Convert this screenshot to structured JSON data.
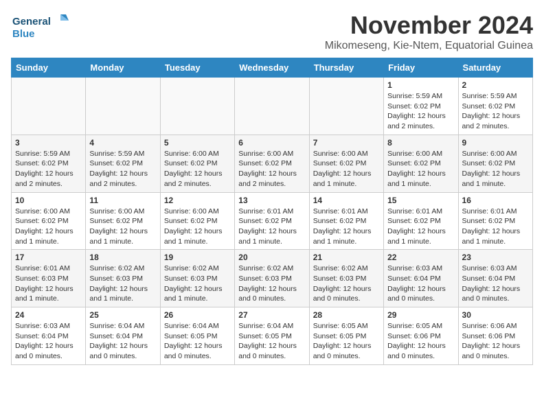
{
  "logo": {
    "line1": "General",
    "line2": "Blue"
  },
  "title": "November 2024",
  "subtitle": "Mikomeseng, Kie-Ntem, Equatorial Guinea",
  "weekdays": [
    "Sunday",
    "Monday",
    "Tuesday",
    "Wednesday",
    "Thursday",
    "Friday",
    "Saturday"
  ],
  "weeks": [
    [
      {
        "day": "",
        "info": ""
      },
      {
        "day": "",
        "info": ""
      },
      {
        "day": "",
        "info": ""
      },
      {
        "day": "",
        "info": ""
      },
      {
        "day": "",
        "info": ""
      },
      {
        "day": "1",
        "info": "Sunrise: 5:59 AM\nSunset: 6:02 PM\nDaylight: 12 hours and 2 minutes."
      },
      {
        "day": "2",
        "info": "Sunrise: 5:59 AM\nSunset: 6:02 PM\nDaylight: 12 hours and 2 minutes."
      }
    ],
    [
      {
        "day": "3",
        "info": "Sunrise: 5:59 AM\nSunset: 6:02 PM\nDaylight: 12 hours and 2 minutes."
      },
      {
        "day": "4",
        "info": "Sunrise: 5:59 AM\nSunset: 6:02 PM\nDaylight: 12 hours and 2 minutes."
      },
      {
        "day": "5",
        "info": "Sunrise: 6:00 AM\nSunset: 6:02 PM\nDaylight: 12 hours and 2 minutes."
      },
      {
        "day": "6",
        "info": "Sunrise: 6:00 AM\nSunset: 6:02 PM\nDaylight: 12 hours and 2 minutes."
      },
      {
        "day": "7",
        "info": "Sunrise: 6:00 AM\nSunset: 6:02 PM\nDaylight: 12 hours and 1 minute."
      },
      {
        "day": "8",
        "info": "Sunrise: 6:00 AM\nSunset: 6:02 PM\nDaylight: 12 hours and 1 minute."
      },
      {
        "day": "9",
        "info": "Sunrise: 6:00 AM\nSunset: 6:02 PM\nDaylight: 12 hours and 1 minute."
      }
    ],
    [
      {
        "day": "10",
        "info": "Sunrise: 6:00 AM\nSunset: 6:02 PM\nDaylight: 12 hours and 1 minute."
      },
      {
        "day": "11",
        "info": "Sunrise: 6:00 AM\nSunset: 6:02 PM\nDaylight: 12 hours and 1 minute."
      },
      {
        "day": "12",
        "info": "Sunrise: 6:00 AM\nSunset: 6:02 PM\nDaylight: 12 hours and 1 minute."
      },
      {
        "day": "13",
        "info": "Sunrise: 6:01 AM\nSunset: 6:02 PM\nDaylight: 12 hours and 1 minute."
      },
      {
        "day": "14",
        "info": "Sunrise: 6:01 AM\nSunset: 6:02 PM\nDaylight: 12 hours and 1 minute."
      },
      {
        "day": "15",
        "info": "Sunrise: 6:01 AM\nSunset: 6:02 PM\nDaylight: 12 hours and 1 minute."
      },
      {
        "day": "16",
        "info": "Sunrise: 6:01 AM\nSunset: 6:02 PM\nDaylight: 12 hours and 1 minute."
      }
    ],
    [
      {
        "day": "17",
        "info": "Sunrise: 6:01 AM\nSunset: 6:03 PM\nDaylight: 12 hours and 1 minute."
      },
      {
        "day": "18",
        "info": "Sunrise: 6:02 AM\nSunset: 6:03 PM\nDaylight: 12 hours and 1 minute."
      },
      {
        "day": "19",
        "info": "Sunrise: 6:02 AM\nSunset: 6:03 PM\nDaylight: 12 hours and 1 minute."
      },
      {
        "day": "20",
        "info": "Sunrise: 6:02 AM\nSunset: 6:03 PM\nDaylight: 12 hours and 0 minutes."
      },
      {
        "day": "21",
        "info": "Sunrise: 6:02 AM\nSunset: 6:03 PM\nDaylight: 12 hours and 0 minutes."
      },
      {
        "day": "22",
        "info": "Sunrise: 6:03 AM\nSunset: 6:04 PM\nDaylight: 12 hours and 0 minutes."
      },
      {
        "day": "23",
        "info": "Sunrise: 6:03 AM\nSunset: 6:04 PM\nDaylight: 12 hours and 0 minutes."
      }
    ],
    [
      {
        "day": "24",
        "info": "Sunrise: 6:03 AM\nSunset: 6:04 PM\nDaylight: 12 hours and 0 minutes."
      },
      {
        "day": "25",
        "info": "Sunrise: 6:04 AM\nSunset: 6:04 PM\nDaylight: 12 hours and 0 minutes."
      },
      {
        "day": "26",
        "info": "Sunrise: 6:04 AM\nSunset: 6:05 PM\nDaylight: 12 hours and 0 minutes."
      },
      {
        "day": "27",
        "info": "Sunrise: 6:04 AM\nSunset: 6:05 PM\nDaylight: 12 hours and 0 minutes."
      },
      {
        "day": "28",
        "info": "Sunrise: 6:05 AM\nSunset: 6:05 PM\nDaylight: 12 hours and 0 minutes."
      },
      {
        "day": "29",
        "info": "Sunrise: 6:05 AM\nSunset: 6:06 PM\nDaylight: 12 hours and 0 minutes."
      },
      {
        "day": "30",
        "info": "Sunrise: 6:06 AM\nSunset: 6:06 PM\nDaylight: 12 hours and 0 minutes."
      }
    ]
  ]
}
